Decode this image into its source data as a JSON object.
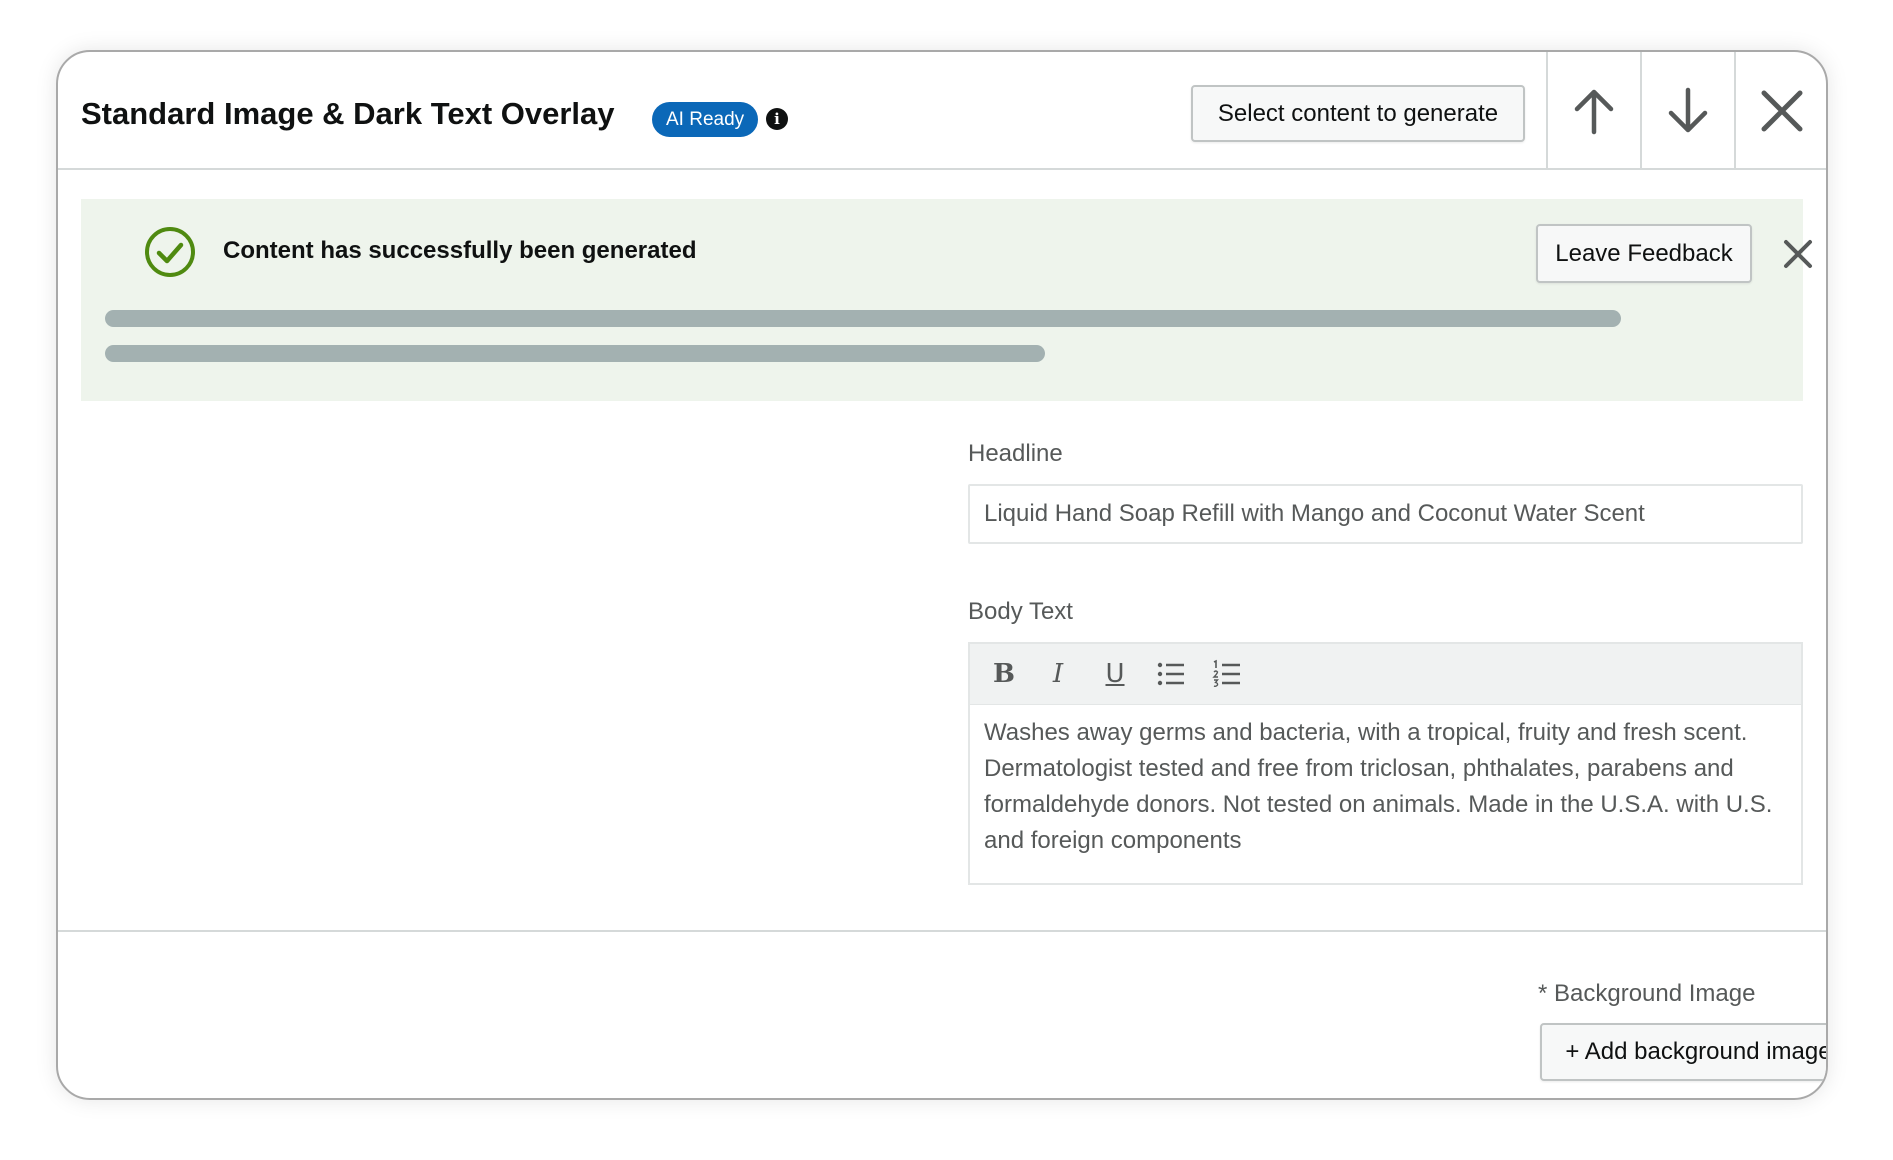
{
  "header": {
    "title": "Standard Image & Dark Text Overlay",
    "badge": "AI Ready",
    "info_icon": "i",
    "generate_button": "Select content to generate"
  },
  "alert": {
    "message": "Content has successfully been generated",
    "feedback_button": "Leave Feedback",
    "status_color": "#4f8a10"
  },
  "form": {
    "headline": {
      "label": "Headline",
      "value": "Liquid Hand Soap Refill with Mango and Coconut Water Scent"
    },
    "body_text": {
      "label": "Body Text",
      "toolbar": {
        "bold": "B",
        "italic": "I",
        "underline": "U"
      },
      "value": "Washes away germs and bacteria, with a tropical, fruity and fresh scent. Dermatologist tested and free from triclosan, phthalates, parabens and formaldehyde donors. Not tested on animals. Made in the U.S.A. with U.S. and foreign components"
    }
  },
  "footer": {
    "background_label": "* Background Image",
    "add_background_button": "+ Add background image"
  },
  "icons": [
    "info-icon",
    "arrow-up-icon",
    "arrow-down-icon",
    "close-icon",
    "check-circle-icon",
    "bullet-list-icon",
    "numbered-list-icon"
  ],
  "colors": {
    "badge": "#0b68b8",
    "alert_background": "#eef4ec",
    "success": "#4f8a10"
  }
}
